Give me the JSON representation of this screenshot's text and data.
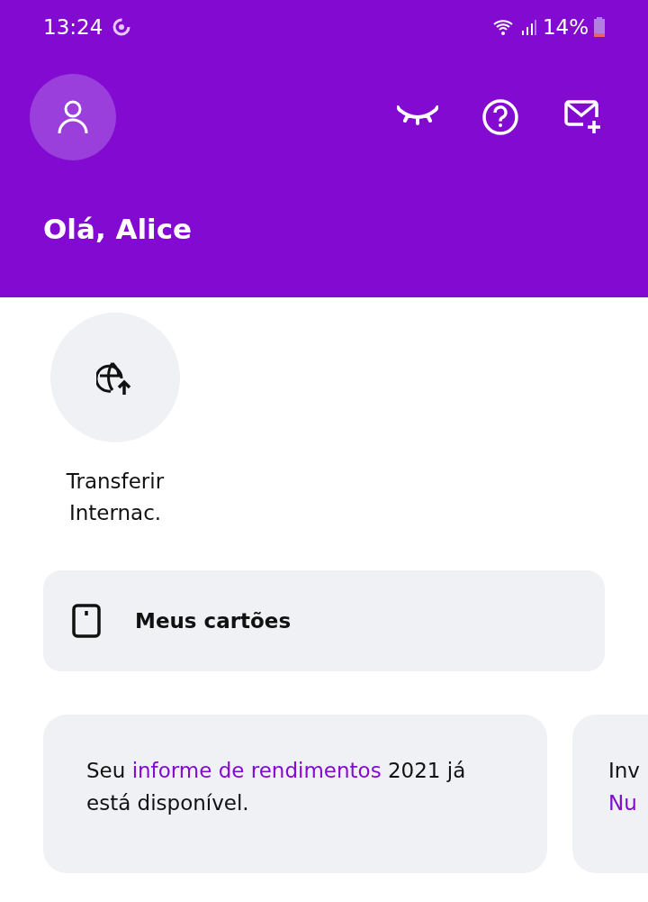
{
  "status_bar": {
    "time": "13:24",
    "battery": "14%"
  },
  "header": {
    "greeting": "Olá, Alice"
  },
  "shortcuts": [
    {
      "label": "Transferir Internac."
    }
  ],
  "cards_button": {
    "label": "Meus cartões"
  },
  "info_cards": [
    {
      "before": "Seu ",
      "link": "informe de rendimentos",
      "after": " 2021 já está disponível."
    },
    {
      "before": "Inv",
      "link": "Nu"
    }
  ]
}
